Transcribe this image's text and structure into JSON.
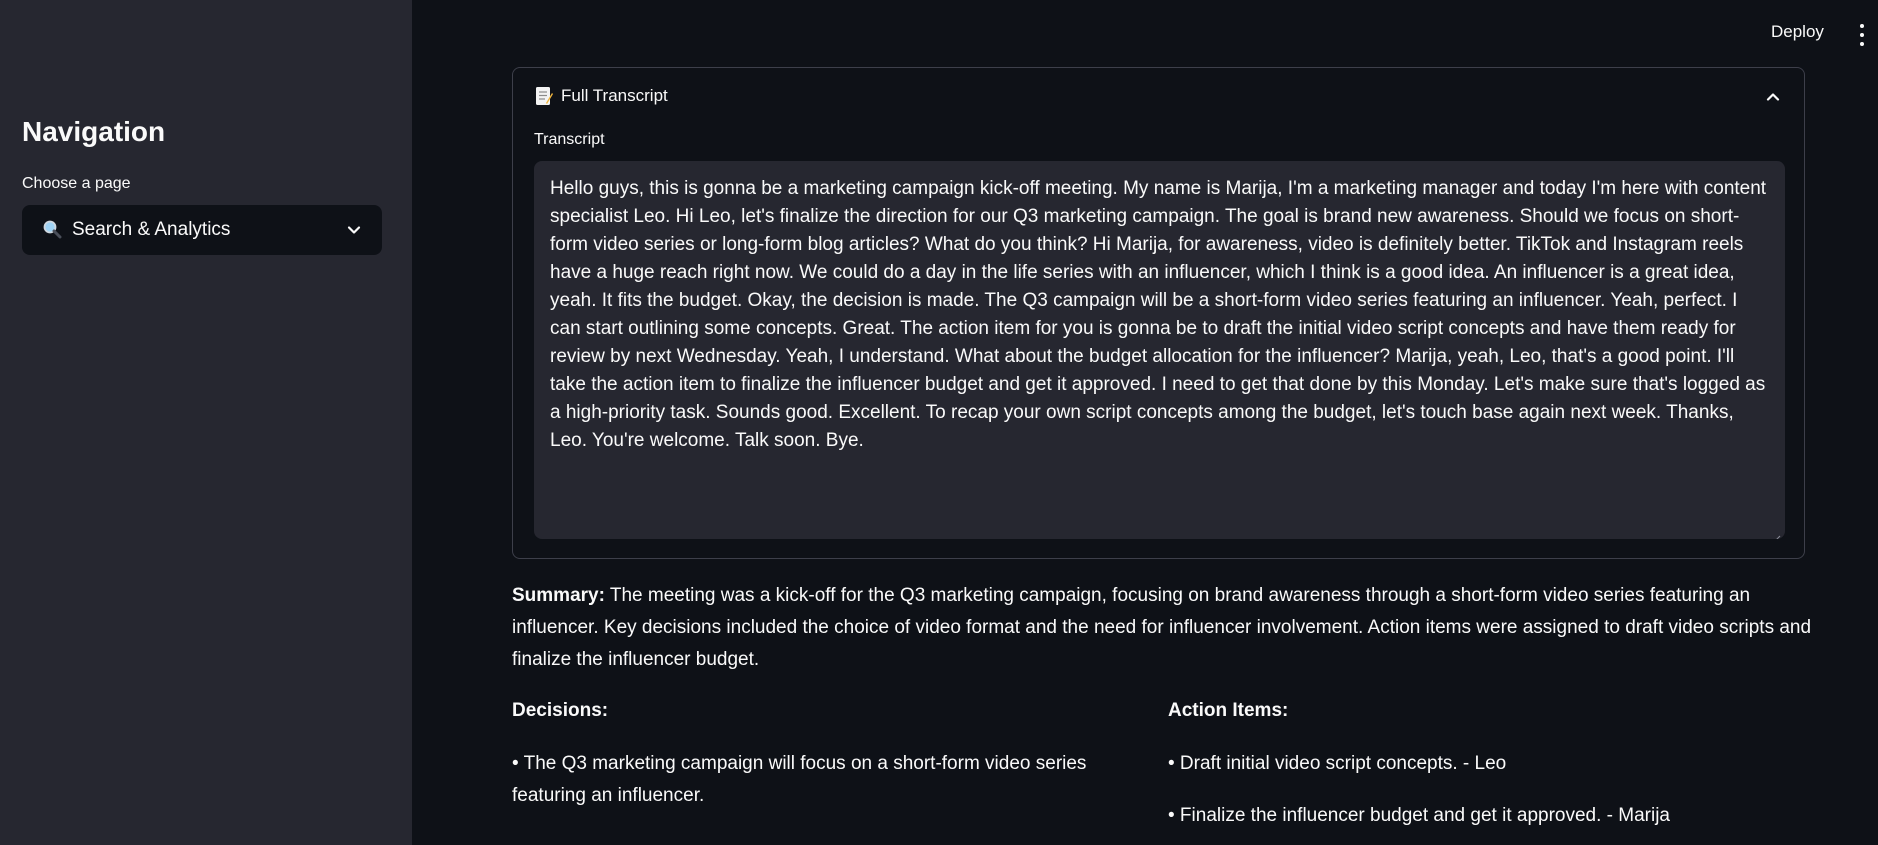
{
  "header": {
    "deploy_label": "Deploy",
    "menu_icon": "kebab-menu-icon"
  },
  "sidebar": {
    "title": "Navigation",
    "select_label": "Choose a page",
    "select_icon": "magnifier-icon",
    "select_value": "Search & Analytics"
  },
  "transcript": {
    "expander_icon": "memo-icon",
    "expander_title": "Full Transcript",
    "label": "Transcript",
    "text": "Hello guys, this is gonna be a marketing campaign kick-off meeting. My name is Marija, I'm a marketing manager and today I'm here with content specialist Leo. Hi Leo, let's finalize the direction for our Q3 marketing campaign. The goal is brand new awareness. Should we focus on short-form video series or long-form blog articles? What do you think? Hi Marija, for awareness, video is definitely better. TikTok and Instagram reels have a huge reach right now. We could do a day in the life series with an influencer, which I think is a good idea. An influencer is a great idea, yeah. It fits the budget. Okay, the decision is made. The Q3 campaign will be a short-form video series featuring an influencer. Yeah, perfect. I can start outlining some concepts. Great. The action item for you is gonna be to draft the initial video script concepts and have them ready for review by next Wednesday. Yeah, I understand. What about the budget allocation for the influencer? Marija, yeah, Leo, that's a good point. I'll take the action item to finalize the influencer budget and get it approved. I need to get that done by this Monday. Let's make sure that's logged as a high-priority task. Sounds good. Excellent. To recap your own script concepts among the budget, let's touch base again next week. Thanks, Leo. You're welcome. Talk soon. Bye."
  },
  "summary": {
    "label": "Summary:",
    "text": " The meeting was a kick-off for the Q3 marketing campaign, focusing on brand awareness through a short-form video series featuring an influencer. Key decisions included the choice of video format and the need for influencer involvement. Action items were assigned to draft video scripts and finalize the influencer budget."
  },
  "decisions": {
    "heading": "Decisions:",
    "items": [
      "• The Q3 marketing campaign will focus on a short-form video series featuring an influencer."
    ]
  },
  "action_items": {
    "heading": "Action Items:",
    "items": [
      "• Draft initial video script concepts. - Leo",
      "• Finalize the influencer budget and get it approved. - Marija"
    ]
  }
}
